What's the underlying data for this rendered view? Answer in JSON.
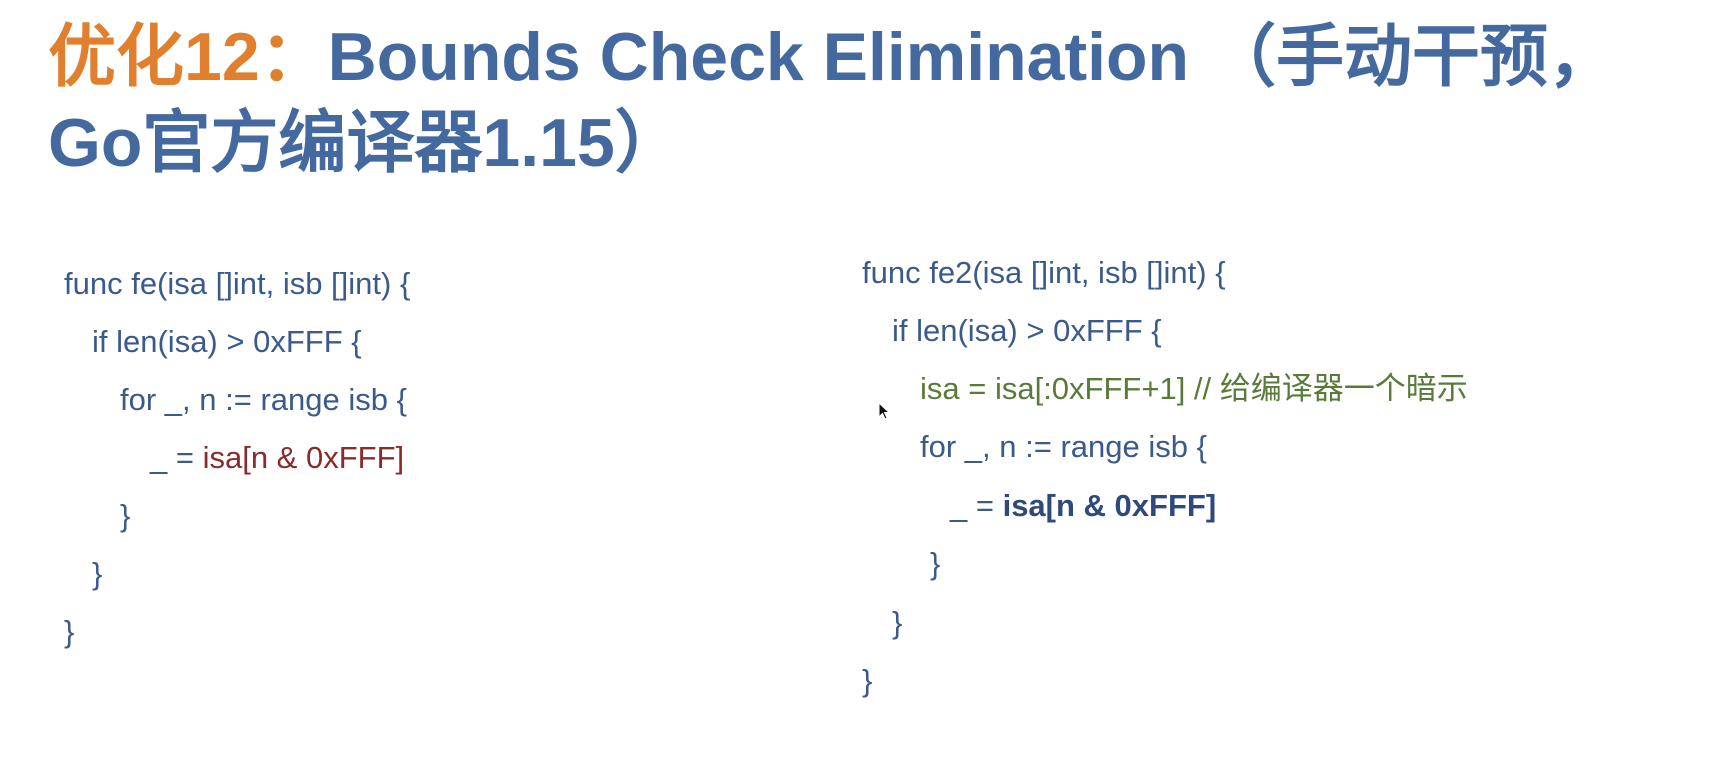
{
  "title": {
    "accent": "优化12：",
    "main": "Bounds Check Elimination （手动干预，Go官方编译器1.15）"
  },
  "left_code": {
    "line1": "func fe(isa []int, isb []int) {",
    "line2": "if len(isa) > 0xFFF {",
    "line3": "for _, n := range isb {",
    "line4_prefix": "_ = ",
    "line4_expr": "isa[n & 0xFFF]",
    "line5": "}",
    "line6": "}",
    "line7": "}"
  },
  "right_code": {
    "line1": "func fe2(isa []int, isb []int) {",
    "line2": "if len(isa) > 0xFFF {",
    "line3": "isa = isa[:0xFFF+1] // 给编译器一个暗示",
    "line4": "for _, n := range isb {",
    "line5_prefix": "_ = ",
    "line5_expr": "isa[n & 0xFFF]",
    "line6": "}",
    "line7": "}",
    "line8": "}"
  },
  "colors": {
    "title_blue": "#44699f",
    "title_orange": "#e07f2e",
    "code_blue": "#3b5a8c",
    "code_red": "#8a2a2a",
    "code_green": "#5a7a3a"
  }
}
